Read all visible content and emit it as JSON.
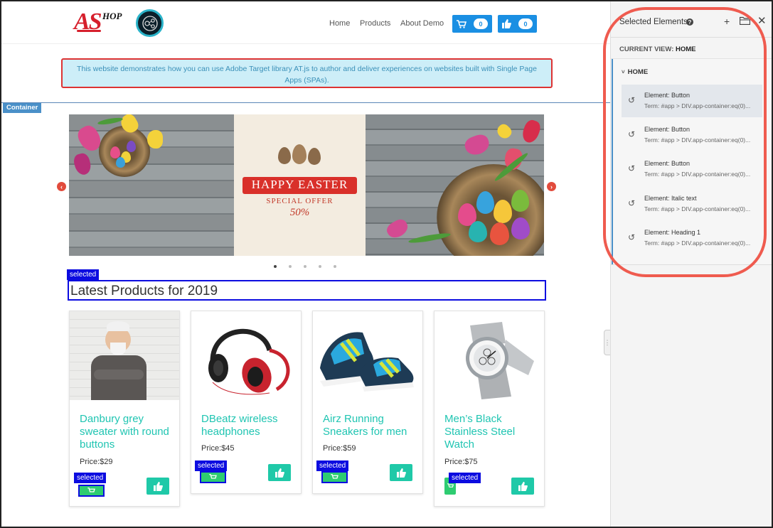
{
  "nav": {
    "logo_shop": "HOP",
    "links": [
      "Home",
      "Products",
      "About Demo"
    ],
    "cart_count": "0",
    "like_count": "0"
  },
  "banner_text": "This website demonstrates how you can use Adobe Target library AT.js to author and deliver experiences on websites built with Single Page Apps (SPAs).",
  "container_label": "Container",
  "carousel": {
    "title": "HAPPY EASTER",
    "subtitle": "SPECIAL OFFER",
    "percent": "50%",
    "dots": 5,
    "active_dot": 0
  },
  "selected_label": "selected",
  "section_heading": "Latest Products for 2019",
  "products": [
    {
      "name": "Danbury grey sweater with round buttons",
      "price": "Price:$29"
    },
    {
      "name": "DBeatz wireless headphones",
      "price": "Price:$45"
    },
    {
      "name": "Airz Running Sneakers for men",
      "price": "Price:$59"
    },
    {
      "name": "Men’s Black Stainless Steel Watch",
      "price": "Price:$75"
    }
  ],
  "panel": {
    "title": "Selected Elements",
    "help": "?",
    "current_view_label": "CURRENT VIEW:",
    "current_view_value": "HOME",
    "group": "HOME",
    "items": [
      {
        "element": "Element: Button",
        "term": "Term: #app > DIV.app-container:eq(0)..."
      },
      {
        "element": "Element: Button",
        "term": "Term: #app > DIV.app-container:eq(0)..."
      },
      {
        "element": "Element: Button",
        "term": "Term: #app > DIV.app-container:eq(0)..."
      },
      {
        "element": "Element: Italic text",
        "term": "Term: #app > DIV.app-container:eq(0)..."
      },
      {
        "element": "Element: Heading 1",
        "term": "Term: #app > DIV.app-container:eq(0)..."
      }
    ]
  },
  "colors": {
    "accent": "#1a8fe3",
    "teal": "#20c5b2",
    "selection": "#0c0ce0",
    "highlight_ring": "#ef5b4f"
  }
}
